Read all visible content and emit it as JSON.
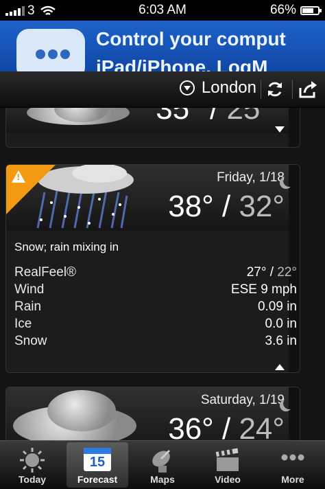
{
  "status_bar": {
    "carrier": "3",
    "time": "6:03 AM",
    "battery": "66%",
    "battery_level": 0.66
  },
  "ad": {
    "line1": "Control your comput",
    "line2": "iPad/iPhone.  LogM"
  },
  "location": {
    "city": "London"
  },
  "forecast": [
    {
      "temp_high": "35°",
      "temp_low": "25°"
    },
    {
      "day": "Friday, 1/18",
      "temp_high": "38°",
      "temp_low": "32°",
      "condition": "Snow; rain mixing in",
      "details": [
        {
          "label": "RealFeel®",
          "value": "27°",
          "value2": "22°"
        },
        {
          "label": "Wind",
          "value": "ESE 9 mph"
        },
        {
          "label": "Rain",
          "value": "0.09 in"
        },
        {
          "label": "Ice",
          "value": "0.0 in"
        },
        {
          "label": "Snow",
          "value": "3.6 in"
        }
      ],
      "alert_icon": "warning-icon"
    },
    {
      "day": "Saturday, 1/19",
      "temp_high": "36°",
      "temp_low": "24°"
    }
  ],
  "tabs": [
    {
      "label": "Today",
      "icon": "sun-icon"
    },
    {
      "label": "Forecast",
      "icon": "calendar-icon",
      "icon_text": "15",
      "active": true
    },
    {
      "label": "Maps",
      "icon": "satellite-dish-icon"
    },
    {
      "label": "Video",
      "icon": "clapperboard-icon"
    },
    {
      "label": "More",
      "icon": "more-dots-icon"
    }
  ]
}
